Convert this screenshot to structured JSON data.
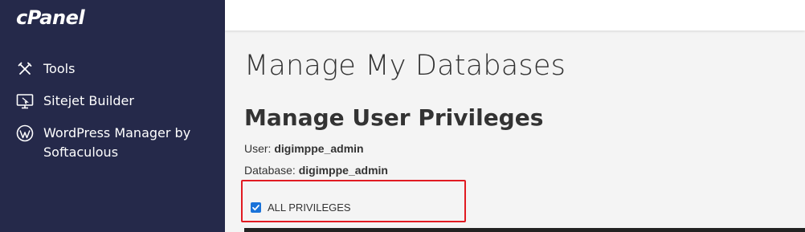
{
  "sidebar": {
    "logo": "cPanel",
    "items": [
      {
        "label": "Tools",
        "icon": "tools-icon"
      },
      {
        "label": "Sitejet Builder",
        "icon": "sitejet-icon"
      },
      {
        "label": "WordPress Manager by Softaculous",
        "icon": "wordpress-icon"
      }
    ]
  },
  "main": {
    "page_title": "Manage My Databases",
    "section_title": "Manage User Privileges",
    "user_label": "User:",
    "user_value": "digimppe_admin",
    "database_label": "Database:",
    "database_value": "digimppe_admin",
    "privilege_label": "ALL PRIVILEGES",
    "privilege_checked": true
  },
  "colors": {
    "sidebar_bg": "#25294a",
    "checkbox": "#1a73d9",
    "highlight": "#e11b22"
  }
}
